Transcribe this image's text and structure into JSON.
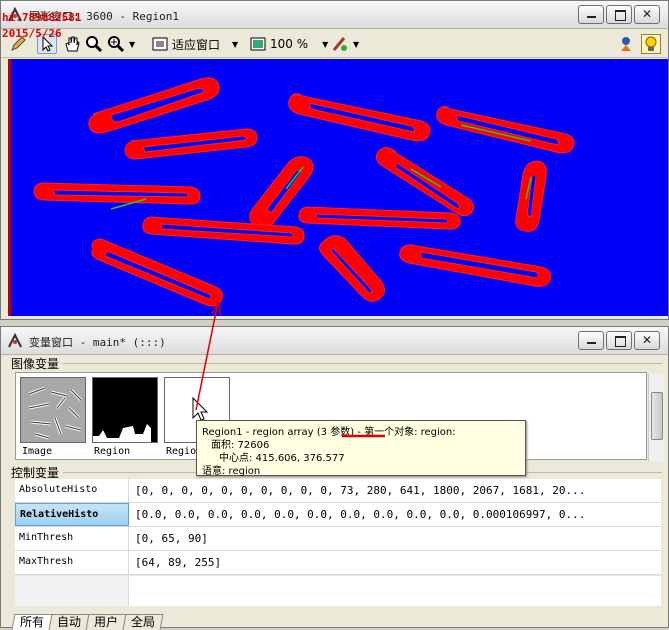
{
  "watermark": {
    "line1": "hi:789882581",
    "line2": "2015/5/26"
  },
  "graphics_window": {
    "title": "图形窗口: 3600 - Region1",
    "toolbar": {
      "zoom_fit": "适应窗口",
      "zoom_percent": "100 %"
    }
  },
  "variable_window": {
    "title": "变量窗口 - main* (:::)",
    "image_vars_header": "图像变量",
    "thumbs": [
      {
        "label": "Image"
      },
      {
        "label": "Region"
      },
      {
        "label": "Region"
      }
    ],
    "tooltip": {
      "line1_a": "Region1 - region array ",
      "line1_b": "(3 参数)",
      "line1_c": " - 第一个对象: region:",
      "line2": "面积: 72606",
      "line3": "中心点: 415.606, 376.577",
      "line4": "语意: region"
    },
    "control_vars_header": "控制变量",
    "control_vars": [
      {
        "name": "AbsoluteHisto",
        "value": "[0, 0, 0, 0, 0, 0, 0, 0, 0, 0, 73, 280, 641, 1800, 2067, 1681, 20..."
      },
      {
        "name": "RelativeHisto",
        "value": "[0.0, 0.0, 0.0, 0.0, 0.0, 0.0, 0.0, 0.0, 0.0, 0.0, 0.000106997, 0..."
      },
      {
        "name": "MinThresh",
        "value": "[0, 65, 90]"
      },
      {
        "name": "MaxThresh",
        "value": "[64, 89, 255]"
      }
    ],
    "tabs": [
      "所有",
      "自动",
      "用户",
      "全局"
    ]
  },
  "colors": {
    "canvas_bg": "#0000f8",
    "region_red": "#ff0000",
    "region_green": "#22cc22",
    "annotation_red": "#e00000"
  }
}
